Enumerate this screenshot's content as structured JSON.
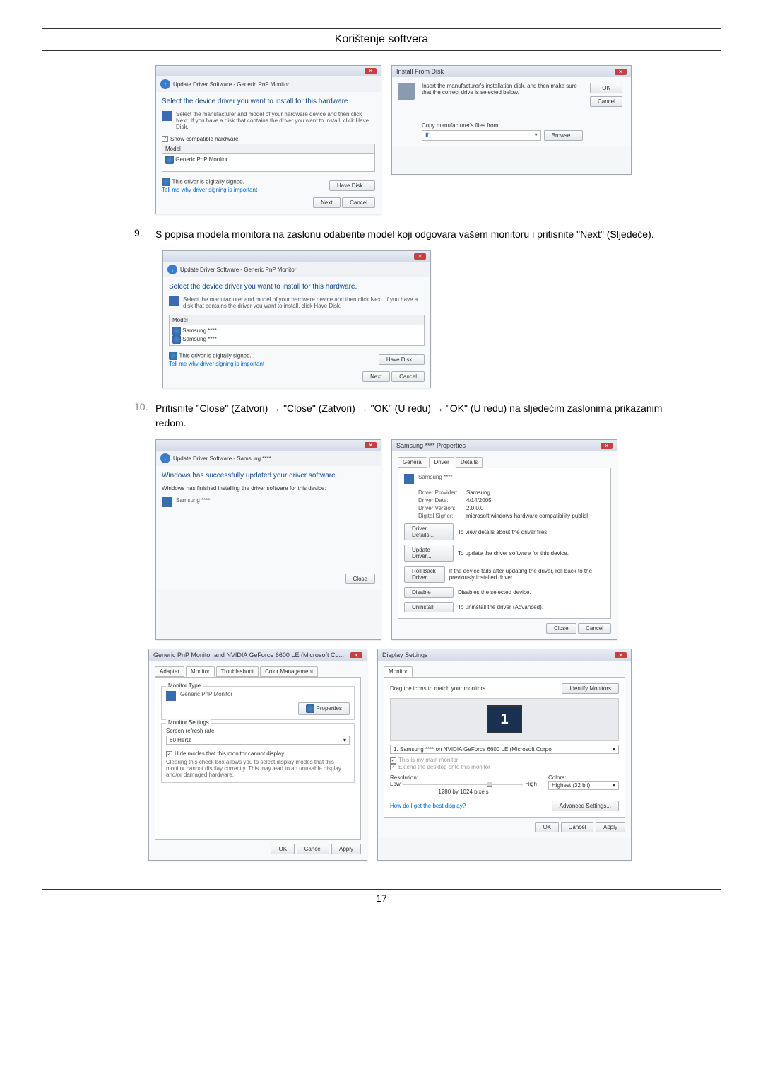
{
  "page": {
    "title": "Korištenje softvera",
    "number": "17"
  },
  "step9": {
    "num": "9.",
    "text": "S popisa modela monitora na zaslonu odaberite model koji odgovara vašem monitoru i pritisnite \"Next\" (Sljedeće)."
  },
  "step10": {
    "num": "10.",
    "text": "Pritisnite \"Close\" (Zatvori) → \"Close\" (Zatvori) → \"OK\" (U redu) → \"OK\" (U redu) na sljedećim zaslonima prikazanim redom."
  },
  "win_update1": {
    "nav": "Update Driver Software - Generic PnP Monitor",
    "heading": "Select the device driver you want to install for this hardware.",
    "sub": "Select the manufacturer and model of your hardware device and then click Next. If you have a disk that contains the driver you want to install, click Have Disk.",
    "check": "Show compatible hardware",
    "model_hdr": "Model",
    "model1": "Generic PnP Monitor",
    "signed": "This driver is digitally signed.",
    "tell": "Tell me why driver signing is important",
    "have_disk": "Have Disk...",
    "next": "Next",
    "cancel": "Cancel"
  },
  "win_install_disk": {
    "title": "Install From Disk",
    "msg": "Insert the manufacturer's installation disk, and then make sure that the correct drive is selected below.",
    "ok": "OK",
    "cancel": "Cancel",
    "copy": "Copy manufacturer's files from:",
    "browse": "Browse..."
  },
  "win_update2": {
    "nav": "Update Driver Software - Generic PnP Monitor",
    "heading": "Select the device driver you want to install for this hardware.",
    "sub": "Select the manufacturer and model of your hardware device and then click Next. If you have a disk that contains the driver you want to install, click Have Disk.",
    "model_hdr": "Model",
    "model1": "Samsung ****",
    "model2": "Samsung ****",
    "signed": "This driver is digitally signed.",
    "tell": "Tell me why driver signing is important",
    "have_disk": "Have Disk...",
    "next": "Next",
    "cancel": "Cancel"
  },
  "win_close": {
    "nav": "Update Driver Software - Samsung ****",
    "heading": "Windows has successfully updated your driver software",
    "sub": "Windows has finished installing the driver software for this device:",
    "device": "Samsung ****",
    "close": "Close"
  },
  "win_props": {
    "title": "Samsung **** Properties",
    "tab_general": "General",
    "tab_driver": "Driver",
    "tab_details": "Details",
    "device": "Samsung ****",
    "provider_lbl": "Driver Provider:",
    "provider": "Samsung",
    "date_lbl": "Driver Date:",
    "date": "4/14/2005",
    "version_lbl": "Driver Version:",
    "version": "2.0.0.0",
    "signer_lbl": "Digital Signer:",
    "signer": "microsoft windows hardware compatibility publisl",
    "details_btn": "Driver Details...",
    "details_txt": "To view details about the driver files.",
    "update_btn": "Update Driver...",
    "update_txt": "To update the driver software for this device.",
    "rollback_btn": "Roll Back Driver",
    "rollback_txt": "If the device fails after updating the driver, roll back to the previously installed driver.",
    "disable_btn": "Disable",
    "disable_txt": "Disables the selected device.",
    "uninstall_btn": "Uninstall",
    "uninstall_txt": "To uninstall the driver (Advanced).",
    "close": "Close",
    "cancel": "Cancel"
  },
  "win_monitor": {
    "title": "Generic PnP Monitor and NVIDIA GeForce 6600 LE (Microsoft Co...",
    "tab_adapter": "Adapter",
    "tab_monitor": "Monitor",
    "tab_trouble": "Troubleshoot",
    "tab_color": "Color Management",
    "type_hdr": "Monitor Type",
    "type_val": "Generic PnP Monitor",
    "props_btn": "Properties",
    "settings_hdr": "Monitor Settings",
    "refresh_lbl": "Screen refresh rate:",
    "refresh_val": "60 Hertz",
    "hide_check": "Hide modes that this monitor cannot display",
    "hide_txt": "Clearing this check box allows you to select display modes that this monitor cannot display correctly. This may lead to an unusable display and/or damaged hardware.",
    "ok": "OK",
    "cancel": "Cancel",
    "apply": "Apply"
  },
  "win_display": {
    "title": "Display Settings",
    "tab_monitor": "Monitor",
    "drag": "Drag the icons to match your monitors.",
    "identify": "Identify Monitors",
    "mon_sel": "1. Samsung **** on NVIDIA GeForce 6600 LE (Microsoft Corpo",
    "main": "This is my main monitor",
    "extend": "Extend the desktop onto this monitor",
    "res_lbl": "Resolution:",
    "low": "Low",
    "high": "High",
    "res_val": "1280 by 1024 pixels",
    "colors_lbl": "Colors:",
    "colors_val": "Highest (32 bit)",
    "best": "How do I get the best display?",
    "adv": "Advanced Settings...",
    "ok": "OK",
    "cancel": "Cancel",
    "apply": "Apply"
  }
}
